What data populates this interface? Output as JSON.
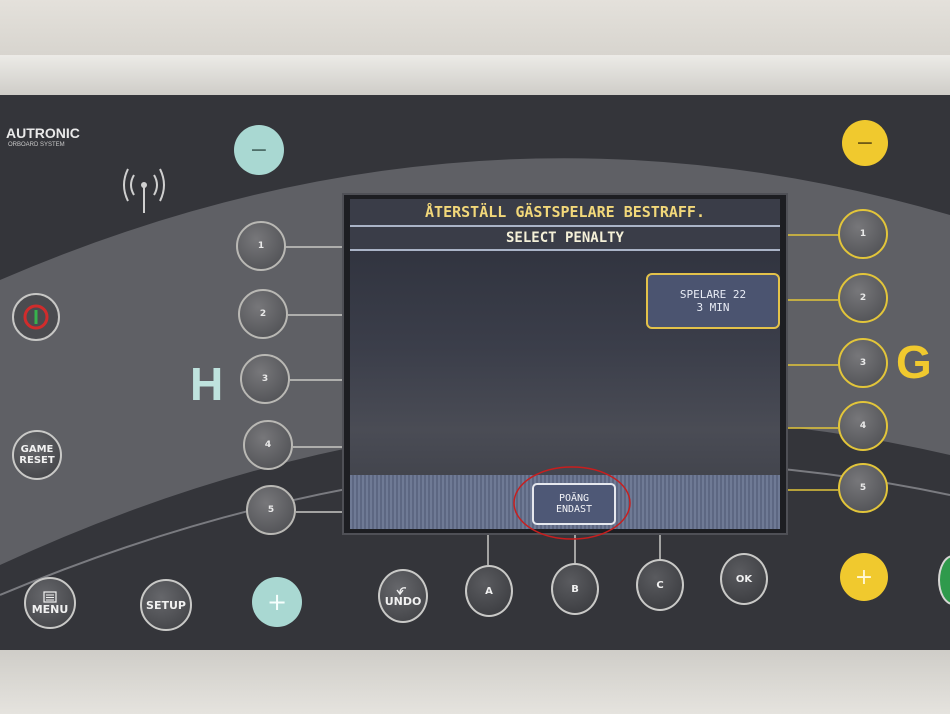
{
  "brand": {
    "logo_text": "AUTRONIC",
    "logo_sub": "ORBOARD SYSTEM"
  },
  "side_labels": {
    "home": "H",
    "guest": "G"
  },
  "screen": {
    "title": "ÅTERSTÄLL GÄSTSPELARE BESTRAFF.",
    "subtitle": "SELECT PENALTY",
    "penalty_line1": "SPELARE 22",
    "penalty_line2": "3 MIN",
    "softkey_line1": "POÄNG",
    "softkey_line2": "ENDAST"
  },
  "left_buttons": [
    "1",
    "2",
    "3",
    "4",
    "5"
  ],
  "right_buttons": [
    "1",
    "2",
    "3",
    "4",
    "5"
  ],
  "controls": {
    "minus": "−",
    "plus": "+",
    "game_reset_line1": "GAME",
    "game_reset_line2": "RESET",
    "menu": "MENU",
    "setup": "SETUP",
    "undo": "UNDO",
    "a": "A",
    "b": "B",
    "c": "C",
    "ok": "OK"
  },
  "colors": {
    "home_accent": "#a9d8d2",
    "guest_accent": "#f0c92e",
    "lcd_text": "#f2d87a",
    "highlight_circle": "#c81e1e"
  }
}
